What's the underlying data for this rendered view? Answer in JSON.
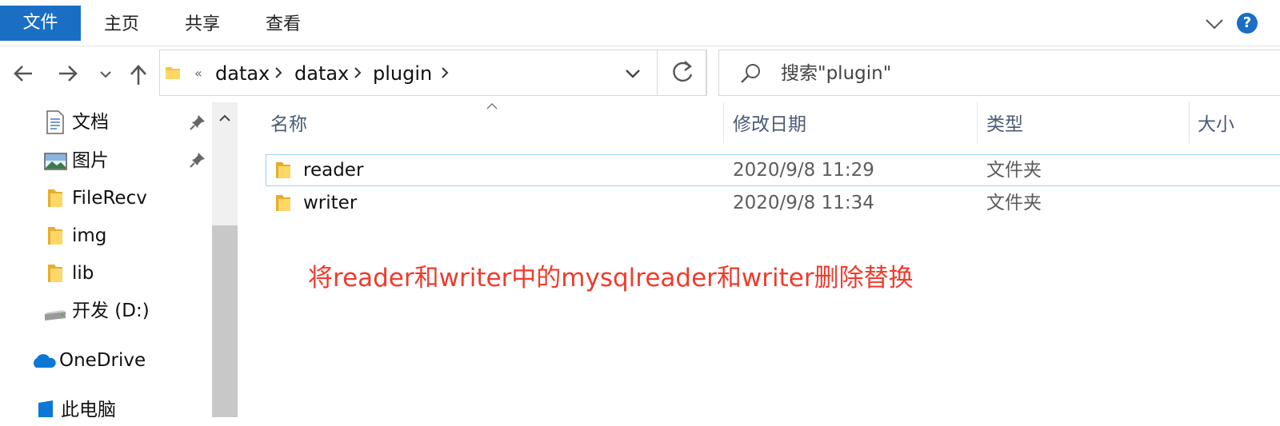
{
  "ribbon": {
    "tabs": [
      {
        "label": "文件",
        "active": true
      },
      {
        "label": "主页",
        "active": false
      },
      {
        "label": "共享",
        "active": false
      },
      {
        "label": "查看",
        "active": false
      }
    ],
    "help": "?"
  },
  "nav": {
    "breadcrumb": {
      "overflow": "«",
      "parts": [
        "datax",
        "datax",
        "plugin"
      ]
    },
    "search": {
      "placeholder": "搜索\"plugin\""
    }
  },
  "sidebar": {
    "items": [
      {
        "label": "文档",
        "icon": "document-icon",
        "pinned": true
      },
      {
        "label": "图片",
        "icon": "pictures-icon",
        "pinned": true
      },
      {
        "label": "FileRecv",
        "icon": "folder-icon",
        "pinned": false
      },
      {
        "label": "img",
        "icon": "folder-icon",
        "pinned": false
      },
      {
        "label": "lib",
        "icon": "folder-icon",
        "pinned": false
      },
      {
        "label": "开发 (D:)",
        "icon": "drive-icon",
        "pinned": false
      },
      {
        "label": "OneDrive",
        "icon": "onedrive-icon",
        "pinned": false
      },
      {
        "label": "此电脑",
        "icon": "this-pc-icon",
        "pinned": false
      }
    ]
  },
  "columns": {
    "name": "名称",
    "modified": "修改日期",
    "type": "类型",
    "size": "大小"
  },
  "files": [
    {
      "name": "reader",
      "modified": "2020/9/8 11:29",
      "type": "文件夹",
      "size": "",
      "selected": true
    },
    {
      "name": "writer",
      "modified": "2020/9/8 11:34",
      "type": "文件夹",
      "size": "",
      "selected": false
    }
  ],
  "annotation": "将reader和writer中的mysqlreader和writer删除替换",
  "colors": {
    "accent": "#1a6fc4",
    "folder": "#f5c443",
    "annotation": "#f23a2b",
    "selection": "#99d1f5"
  }
}
